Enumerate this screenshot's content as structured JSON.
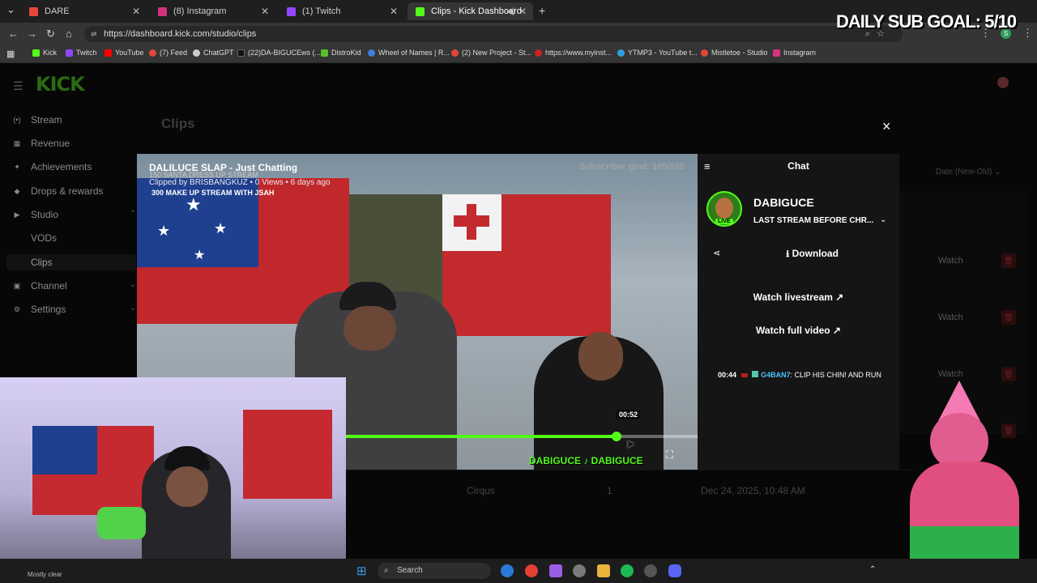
{
  "browser": {
    "tabs": [
      {
        "label": "DARE",
        "color": "#e8463b"
      },
      {
        "label": "(8) Instagram",
        "color": "#d6317f"
      },
      {
        "label": "(1) Twitch",
        "color": "#9147ff"
      },
      {
        "label": "Clips - Kick Dashboard",
        "color": "#53fc18"
      }
    ],
    "new_tab": "+",
    "url": "https://dashboard.kick.com/studio/clips",
    "bookmarks": [
      {
        "label": "Kick",
        "color": "#53fc18"
      },
      {
        "label": "Twitch",
        "color": "#9147ff"
      },
      {
        "label": "YouTube",
        "color": "#ff0000"
      },
      {
        "label": "(7) Feed",
        "color": "#e2463b"
      },
      {
        "label": "ChatGPT",
        "color": "#cccccc"
      },
      {
        "label": "(22)DA-BIGUCEws (...",
        "color": "#111111"
      },
      {
        "label": "DistroKid",
        "color": "#58c12b"
      },
      {
        "label": "Wheel of Names | R...",
        "color": "#3f7de0"
      },
      {
        "label": "(2) New Project - St...",
        "color": "#e2463b"
      },
      {
        "label": "https://www.myinst...",
        "color": "#cc2222"
      },
      {
        "label": "YTMP3 - YouTube t...",
        "color": "#2fa0e0"
      },
      {
        "label": "Mistletoe - Studio",
        "color": "#e2463b"
      },
      {
        "label": "Instagram",
        "color": "#d6317f"
      }
    ]
  },
  "overlay": {
    "sub_goal": "DAILY SUB GOAL: 5/10"
  },
  "dashboard": {
    "logo": "KICK",
    "page_title": "Clips",
    "sort_label": "Date (New-Old)",
    "nav": [
      {
        "label": "Stream",
        "icon": "(•)"
      },
      {
        "label": "Revenue",
        "icon": "▦"
      },
      {
        "label": "Achievements",
        "icon": "✦"
      },
      {
        "label": "Drops & rewards",
        "icon": "◆"
      },
      {
        "label": "Studio",
        "icon": "▶"
      },
      {
        "label": "VODs",
        "icon": ""
      },
      {
        "label": "Clips",
        "icon": ""
      },
      {
        "label": "Channel",
        "icon": "▣"
      },
      {
        "label": "Settings",
        "icon": "⚙"
      }
    ],
    "row_watch": "Watch",
    "bottom_row": {
      "title": "Cirqus",
      "count": "1",
      "date": "Dec 24, 2025, 10:48 AM"
    }
  },
  "modal": {
    "close": "×",
    "video": {
      "title": "DALILUCE SLAP - Just Chatting",
      "meta": "Clipped by BRISBANGKUZ • 0 Views • 6 days ago",
      "overlay_line1": "150 SANTA DRESS UP STREAM",
      "overlay_line2": "300 MAKE UP STREAM WITH JSAH",
      "sub_goal": "Subscriber goal: 105/100",
      "time": "00:52",
      "progress": 0.77,
      "watermark": "DABIGUCE ♪ DABIGUCE"
    },
    "panel": {
      "tab_label": "Chat",
      "channel": "DABIGUCE",
      "stream_title": "LAST STREAM BEFORE CHR...",
      "live_badge": "LIVE",
      "download": "Download",
      "watch_livestream": "Watch livestream",
      "watch_full": "Watch full video",
      "chat": {
        "time": "00:44",
        "user": "G4BAN7",
        "message": ": CLIP HIS CHIN! AND RUN"
      }
    }
  },
  "taskbar": {
    "search": "Search",
    "weather": "Mostly clear"
  }
}
